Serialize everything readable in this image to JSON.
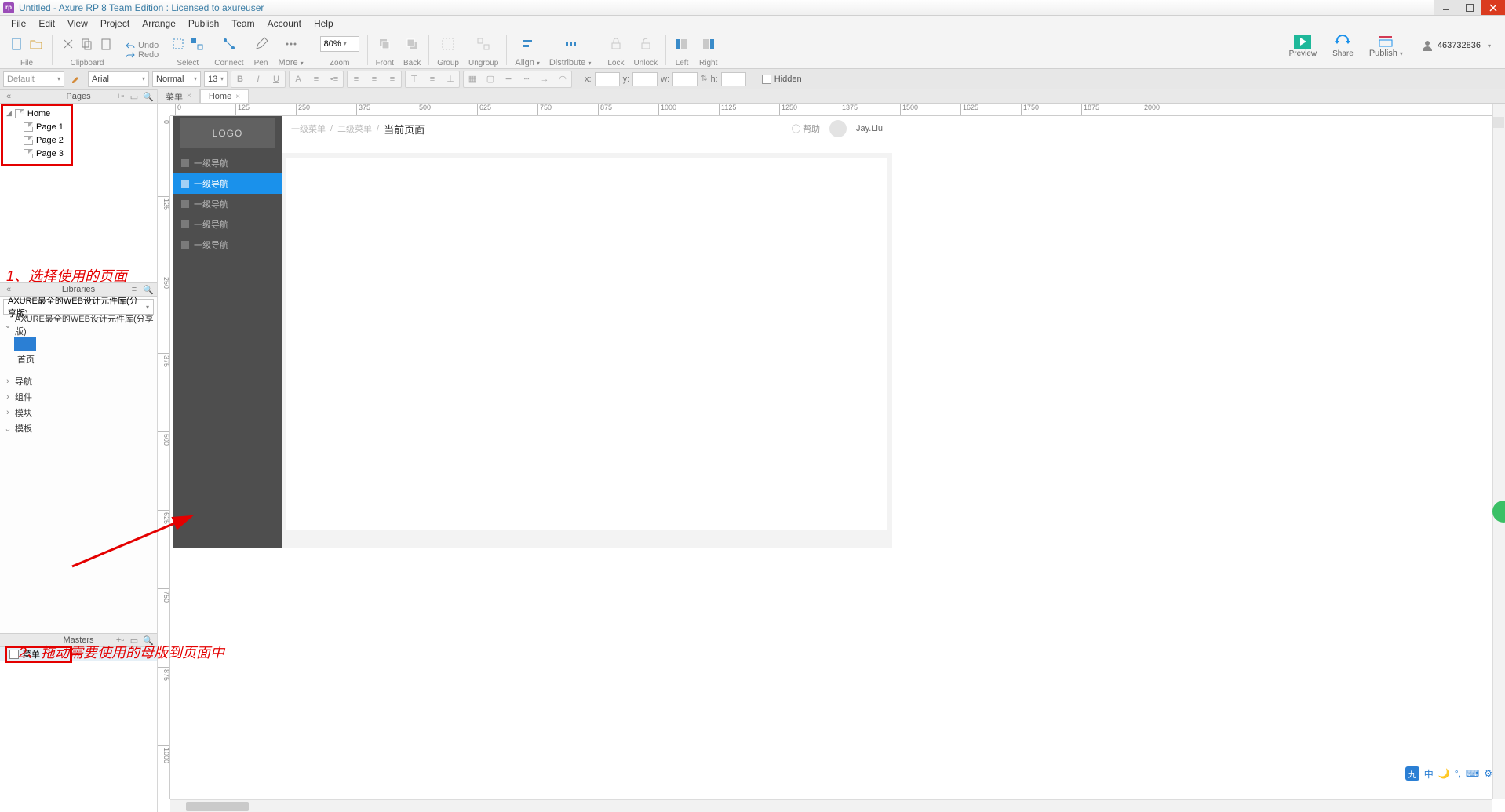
{
  "window": {
    "title": "Untitled - Axure RP 8 Team Edition : Licensed to axureuser"
  },
  "menu": [
    "File",
    "Edit",
    "View",
    "Project",
    "Arrange",
    "Publish",
    "Team",
    "Account",
    "Help"
  ],
  "toolbar": {
    "file": "File",
    "clipboard": "Clipboard",
    "undo": "Undo",
    "redo": "Redo",
    "select": "Select",
    "connect": "Connect",
    "pen": "Pen",
    "more": "More",
    "zoom": "Zoom",
    "zoom_val": "80%",
    "front": "Front",
    "back": "Back",
    "group": "Group",
    "ungroup": "Ungroup",
    "align": "Align",
    "distribute": "Distribute",
    "lock": "Lock",
    "unlock": "Unlock",
    "left": "Left",
    "right": "Right",
    "preview": "Preview",
    "share": "Share",
    "publish": "Publish"
  },
  "user": {
    "name": "463732836"
  },
  "formatbar": {
    "style": "Default",
    "font": "Arial",
    "weight": "Normal",
    "size": "13",
    "hidden": "Hidden",
    "x": "x:",
    "y": "y:",
    "w": "w:",
    "h": "h:"
  },
  "pages": {
    "header": "Pages",
    "items": [
      "Home",
      "Page 1",
      "Page 2",
      "Page 3"
    ]
  },
  "libraries": {
    "header": "Libraries",
    "selected": "AXURE最全的WEB设计元件库(分享版)",
    "root": "AXURE最全的WEB设计元件库(分享版)",
    "thumb": "首页",
    "cats": [
      "导航",
      "组件",
      "模块",
      "模板"
    ]
  },
  "masters": {
    "header": "Masters",
    "item": "菜单"
  },
  "tabs": [
    {
      "label": "菜单"
    },
    {
      "label": "Home"
    }
  ],
  "ruler_h": [
    0,
    125,
    250,
    375,
    500,
    625,
    750,
    875,
    1000,
    1125,
    1250,
    1375,
    1500,
    1625,
    1750,
    1875,
    2000
  ],
  "ruler_v": [
    0,
    125,
    250,
    375,
    500,
    625,
    750,
    875,
    1000
  ],
  "mockup": {
    "logo": "LOGO",
    "navs": [
      "一级导航",
      "一级导航",
      "一级导航",
      "一级导航",
      "一级导航"
    ],
    "crumb1": "一级菜单",
    "crumb2": "二级菜单",
    "current": "当前页面",
    "help": "帮助",
    "username": "Jay.Liu"
  },
  "anno": {
    "a1": "1、选择使用的页面",
    "a2": "2、拖动需要使用的母版到页面中"
  },
  "ime": {
    "label": "中"
  }
}
